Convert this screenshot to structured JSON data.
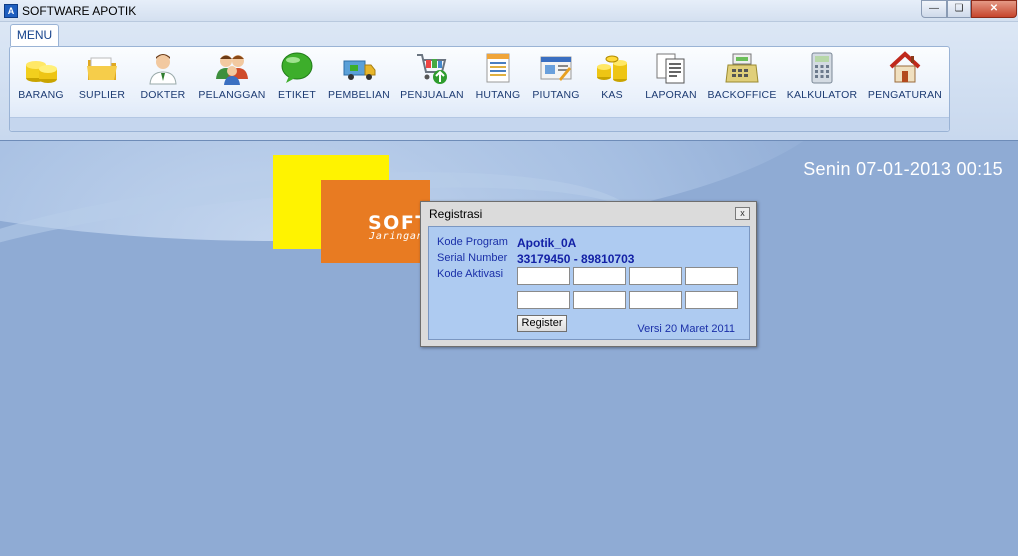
{
  "window": {
    "title": "SOFTWARE APOTIK",
    "icon_text": "A",
    "controls": [
      "minimize",
      "maximize",
      "close"
    ]
  },
  "ribbon": {
    "tab_label": "MENU",
    "buttons": [
      {
        "label": "BARANG",
        "icon": "coins-stack-icon"
      },
      {
        "label": "SUPLIER",
        "icon": "folder-icon"
      },
      {
        "label": "DOKTER",
        "icon": "doctor-icon"
      },
      {
        "label": "PELANGGAN",
        "icon": "customers-icon"
      },
      {
        "label": "ETIKET",
        "icon": "speech-bubble-icon"
      },
      {
        "label": "PEMBELIAN",
        "icon": "delivery-truck-icon"
      },
      {
        "label": "PENJUALAN",
        "icon": "shopping-cart-icon"
      },
      {
        "label": "HUTANG",
        "icon": "ledger-icon"
      },
      {
        "label": "PIUTANG",
        "icon": "receivable-icon"
      },
      {
        "label": "KAS",
        "icon": "cash-coins-icon"
      },
      {
        "label": "LAPORAN",
        "icon": "report-documents-icon"
      },
      {
        "label": "BACKOFFICE",
        "icon": "cash-register-icon"
      },
      {
        "label": "KALKULATOR",
        "icon": "calculator-icon"
      },
      {
        "label": "PENGATURAN",
        "icon": "house-settings-icon"
      }
    ]
  },
  "desktop": {
    "datetime": "Senin  07-01-2013  00:15",
    "logo_title": "SOFTWARE APOTIK",
    "logo_subtitle": "Jaringan - barcode support",
    "colors": {
      "background": "#8fabd4",
      "logo_yellow": "#fff300",
      "logo_orange": "#e87b22"
    }
  },
  "dialog": {
    "title": "Registrasi",
    "close_label": "x",
    "kode_program_label": "Kode Program",
    "kode_program_value": "Apotik_0A",
    "serial_number_label": "Serial Number",
    "serial_number_value": "33179450 - 89810703",
    "kode_aktivasi_label": "Kode Aktivasi",
    "activation_fields": [
      "",
      "",
      "",
      "",
      "",
      "",
      "",
      ""
    ],
    "register_label": "Register",
    "version": "Versi 20 Maret 2011"
  }
}
